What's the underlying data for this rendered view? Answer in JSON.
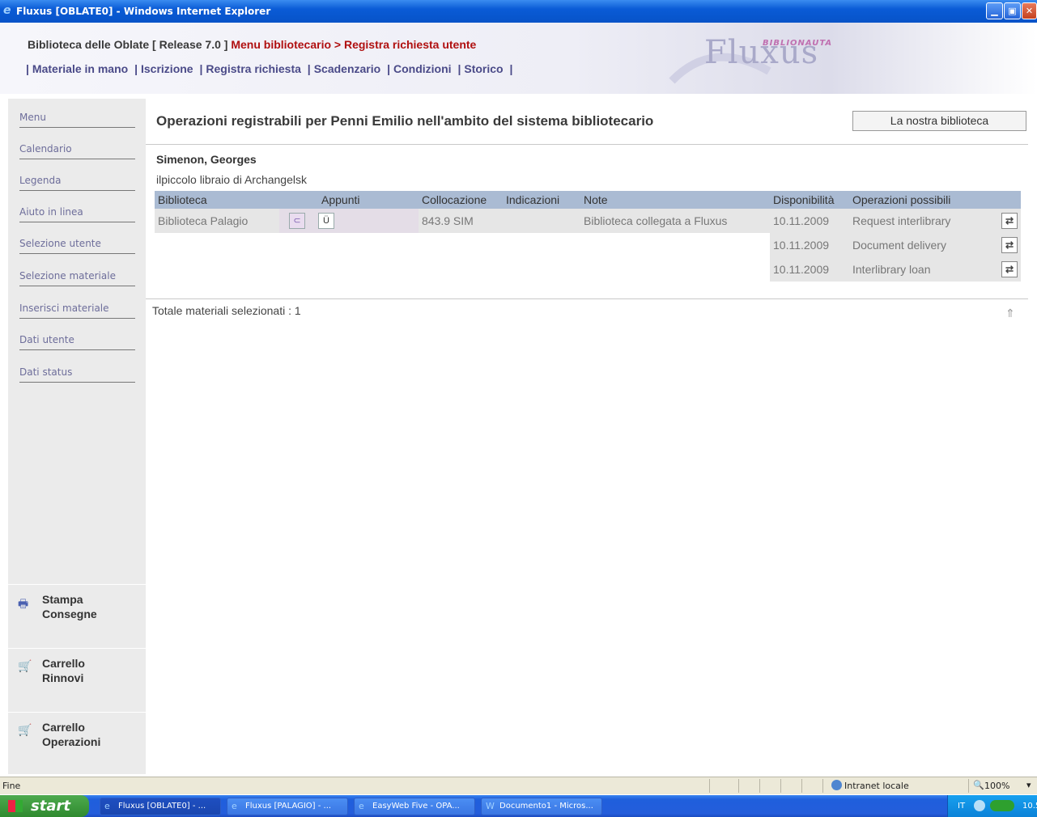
{
  "window": {
    "title": "Fluxus [OBLATE0] - Windows Internet Explorer"
  },
  "header": {
    "library": "Biblioteca delle Oblate [ Release 7.0 ]",
    "crumb": "Menu bibliotecario > Registra richiesta utente",
    "nav": [
      "Materiale in mano",
      "Iscrizione",
      "Registra richiesta",
      "Scadenzario",
      "Condizioni",
      "Storico"
    ],
    "logo_tag": "BIBLIONAUTA",
    "logo_name": "Fluxus"
  },
  "sidebar": {
    "items": [
      "Menu",
      "Calendario",
      "Legenda",
      "Aiuto in linea",
      "Selezione utente",
      "Selezione materiale",
      "Inserisci materiale",
      "Dati utente",
      "Dati status"
    ],
    "blocks": [
      {
        "line1": "Stampa",
        "line2": "Consegne",
        "icon": "printer-icon"
      },
      {
        "line1": "Carrello",
        "line2": "Rinnovi",
        "icon": "cart-icon"
      },
      {
        "line1": "Carrello",
        "line2": "Operazioni",
        "icon": "cart-icon"
      }
    ]
  },
  "main": {
    "title": "Operazioni registrabili per Penni Emilio nell'ambito del sistema bibliotecario",
    "nostra_button": "La nostra biblioteca",
    "author": "Simenon, Georges",
    "book_title": "ilpiccolo libraio di Archangelsk",
    "table": {
      "headers": [
        "Biblioteca",
        "",
        "Appunti",
        "Collocazione",
        "Indicazioni",
        "Note",
        "Disponibilità",
        "Operazioni possibili",
        ""
      ],
      "library": "Biblioteca Palagio",
      "collocation": "843.9 SIM",
      "note": "Biblioteca collegata a Fluxus",
      "rows": [
        {
          "date": "10.11.2009",
          "operation": "Request interlibrary"
        },
        {
          "date": "10.11.2009",
          "operation": "Document delivery"
        },
        {
          "date": "10.11.2009",
          "operation": "Interlibrary loan"
        }
      ]
    },
    "total": "Totale materiali selezionati : 1"
  },
  "statusbar": {
    "left": "Fine",
    "zone": "Intranet locale",
    "zoom": "100%"
  },
  "taskbar": {
    "start": "start",
    "tasks": [
      "Fluxus [OBLATE0] - ...",
      "Fluxus [PALAGIO] - ...",
      "EasyWeb Five - OPA...",
      "Documento1 - Micros..."
    ],
    "lang": "IT",
    "clock": "10.5"
  }
}
